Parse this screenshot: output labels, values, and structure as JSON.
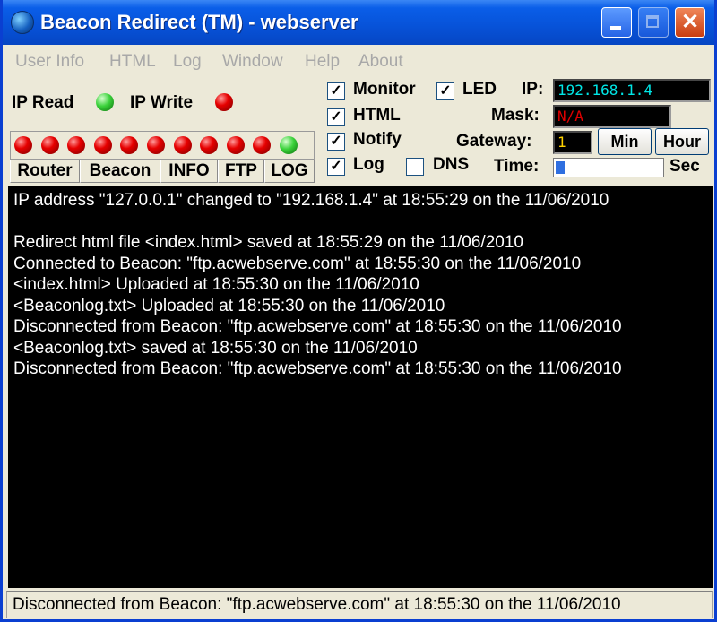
{
  "window": {
    "title": "Beacon Redirect (TM) - webserver",
    "close_glyph": "✕"
  },
  "menu": [
    "User Info",
    "HTML",
    "Log",
    "Window",
    "Help",
    "About"
  ],
  "indicators": {
    "ip_read_label": "IP Read",
    "ip_write_label": "IP Write",
    "ip_read_color": "green",
    "ip_write_color": "red"
  },
  "led_row": [
    "red",
    "red",
    "red",
    "red",
    "red",
    "red",
    "red",
    "red",
    "red",
    "red",
    "green"
  ],
  "tabs": [
    "Router",
    "Beacon",
    "INFO",
    "FTP",
    "LOG"
  ],
  "checkboxes": {
    "monitor": {
      "label": "Monitor",
      "checked": true
    },
    "led": {
      "label": "LED",
      "checked": true
    },
    "html": {
      "label": "HTML",
      "checked": true
    },
    "notify": {
      "label": "Notify",
      "checked": true
    },
    "log": {
      "label": "Log",
      "checked": true
    },
    "dns": {
      "label": "DNS",
      "checked": false
    }
  },
  "fields": {
    "ip_label": "IP:",
    "ip_value": "192.168.1.4",
    "mask_label": "Mask:",
    "mask_value": "N/A",
    "gateway_label": "Gateway:",
    "gateway_value": "1",
    "time_label": "Time:",
    "time_unit": "Sec"
  },
  "buttons": {
    "min": "Min",
    "hour": "Hour"
  },
  "time_progress": 0.08,
  "colors": {
    "ip_text": "#00e6e6",
    "mask_text": "#e00000",
    "gateway_text": "#ffd200",
    "log_bg": "#000000"
  },
  "log_lines": [
    "IP address \"127.0.0.1\" changed to \"192.168.1.4\" at 18:55:29 on the 11/06/2010",
    "",
    "Redirect html file <index.html> saved at 18:55:29 on the 11/06/2010",
    "Connected to Beacon: \"ftp.acwebserve.com\" at 18:55:30 on the 11/06/2010",
    "<index.html> Uploaded at 18:55:30 on the 11/06/2010",
    "<Beaconlog.txt> Uploaded at 18:55:30 on the 11/06/2010",
    "Disconnected from Beacon: \"ftp.acwebserve.com\" at 18:55:30 on the 11/06/2010",
    "<Beaconlog.txt> saved at 18:55:30 on the 11/06/2010",
    "Disconnected from Beacon: \"ftp.acwebserve.com\" at 18:55:30 on the 11/06/2010"
  ],
  "status": "Disconnected from Beacon: \"ftp.acwebserve.com\" at 18:55:30 on the 11/06/2010"
}
